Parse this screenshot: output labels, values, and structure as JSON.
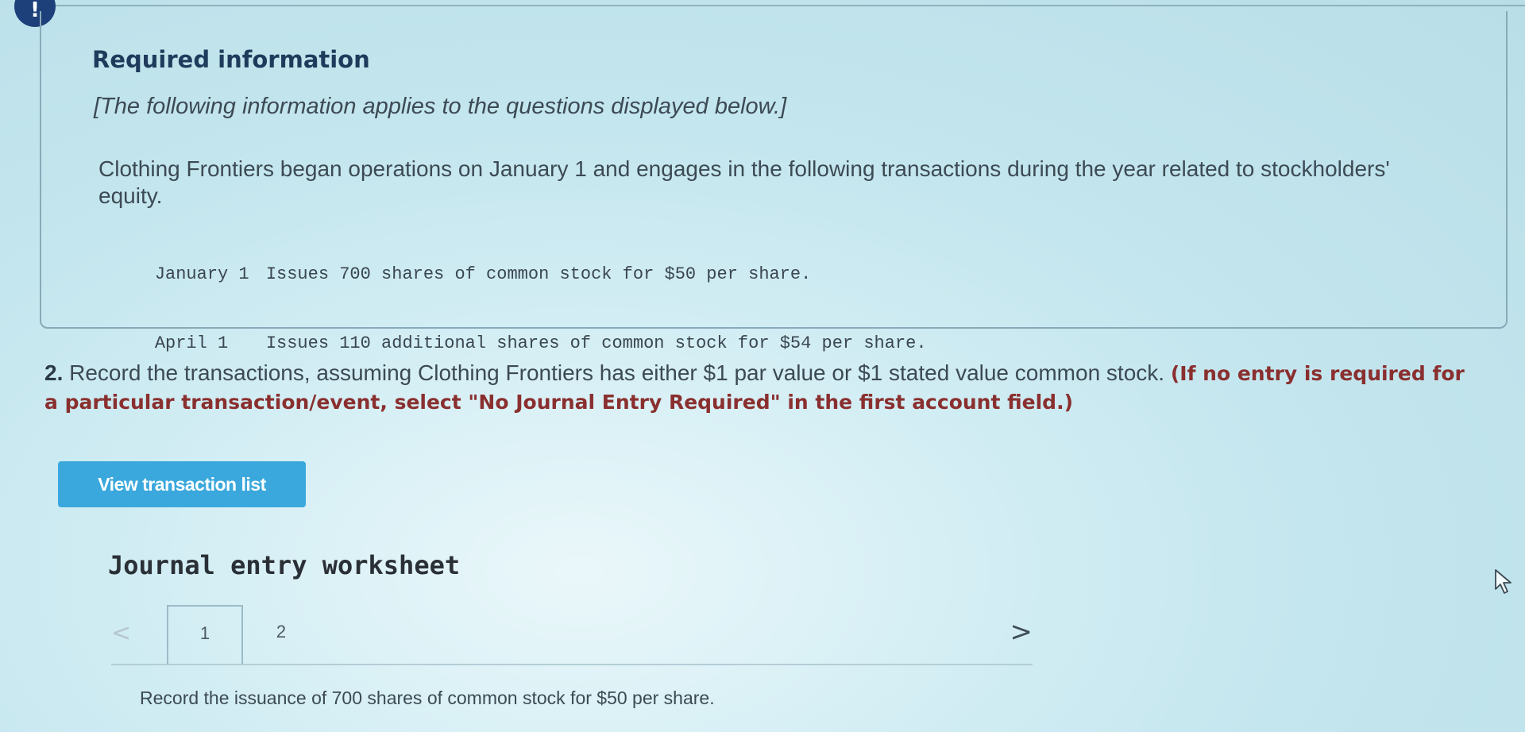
{
  "info": {
    "title": "Required information",
    "note": "[The following information applies to the questions displayed below.]",
    "paragraph": "Clothing Frontiers began operations on January 1 and engages in the following transactions during the year related to stockholders' equity.",
    "transactions": [
      {
        "date": "January 1",
        "text": "Issues 700 shares of common stock for $50 per share."
      },
      {
        "date": "April 1",
        "text": "Issues 110 additional shares of common stock for $54 per share."
      }
    ]
  },
  "question": {
    "number": "2.",
    "text": "Record the transactions, assuming Clothing Frontiers has either $1 par value or $1 stated value common stock.",
    "hint": "(If no entry is required for a particular transaction/event, select \"No Journal Entry Required\" in the first account field.)"
  },
  "buttons": {
    "view_transaction_list": "View transaction list"
  },
  "worksheet": {
    "title": "Journal entry worksheet",
    "prev_icon": "chevron-left-icon",
    "next_icon": "chevron-right-icon",
    "prev_glyph": "<",
    "next_glyph": ">",
    "tabs": [
      "1",
      "2"
    ],
    "active_tab": "1",
    "instruction": "Record the issuance of 700 shares of common stock for $50 per share."
  },
  "colors": {
    "button": "#3aa8dc",
    "alert_badge": "#1d3f7a",
    "hint_text": "#8a2f2f"
  }
}
